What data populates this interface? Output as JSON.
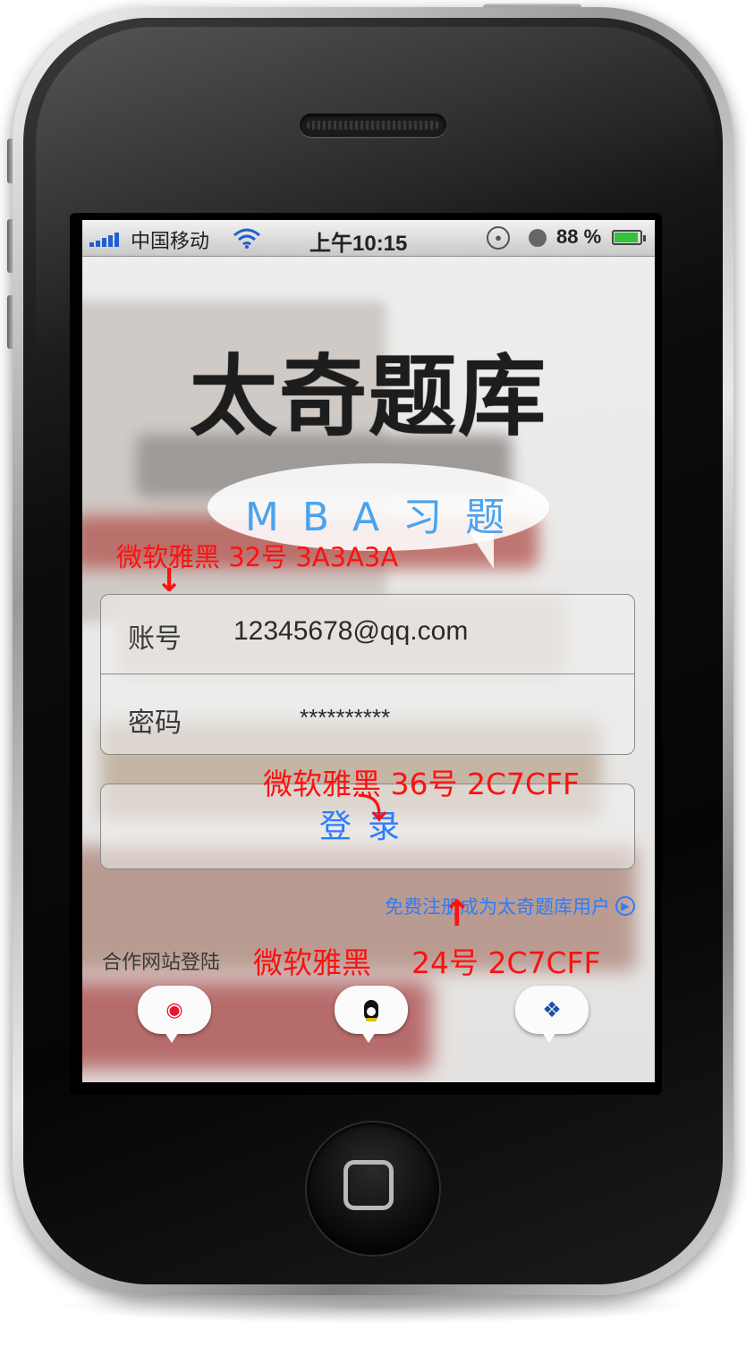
{
  "status_bar": {
    "carrier": "中国移动",
    "time": "上午10:15",
    "battery": "88 %",
    "battery_level": 0.88,
    "icons": [
      "signal-bars-icon",
      "wifi-icon",
      "rotation-lock-icon",
      "alarm-clock-icon",
      "battery-icon"
    ]
  },
  "app": {
    "title": "太奇题库",
    "subtitle": "MBA习题"
  },
  "login_form": {
    "account_label": "账号",
    "account_value": "12345678@qq.com",
    "password_label": "密码",
    "password_value": "**********",
    "login_button": "登录"
  },
  "register_link": "免费注册成为太奇题库用户",
  "partner": {
    "label": "合作网站登陆",
    "buttons": [
      {
        "icon": "weibo-icon"
      },
      {
        "icon": "qq-penguin-icon"
      },
      {
        "icon": "partner-logo-icon"
      }
    ]
  },
  "annotations": [
    "微软雅黑 32号  3A3A3A",
    "微软雅黑 36号 2C7CFF",
    "微软雅黑",
    "24号 2C7CFF"
  ],
  "colors": {
    "label_gray": "#3A3A3A",
    "accent_blue": "#2C7CFF",
    "subtitle_blue": "#4AA3EE",
    "annotation_red": "#FF1010"
  }
}
